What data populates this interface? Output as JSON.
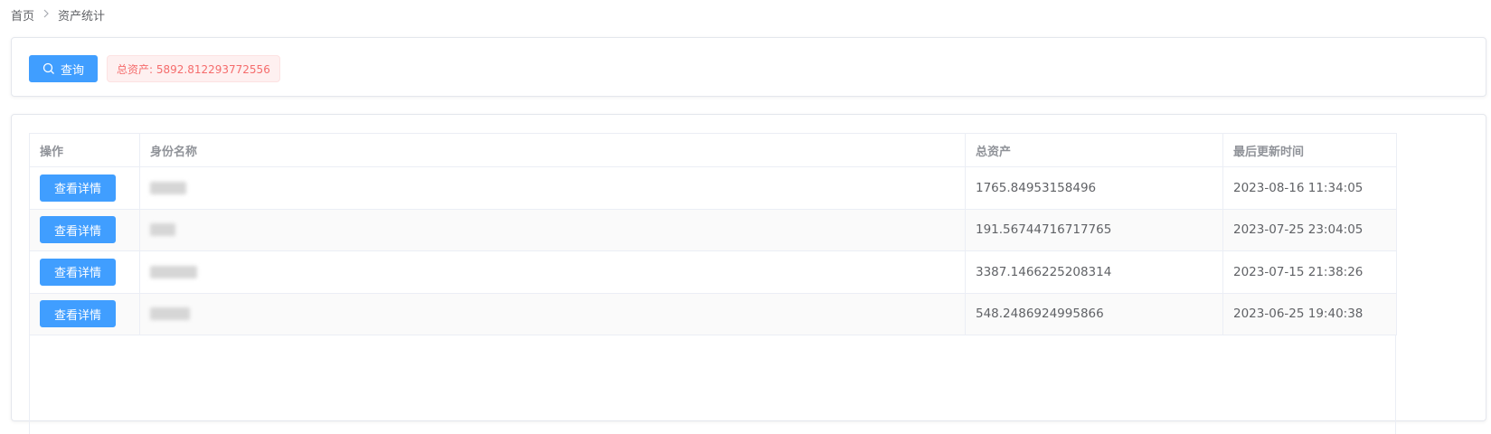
{
  "breadcrumb": {
    "home": "首页",
    "current": "资产统计"
  },
  "query": {
    "search_button_label": "查询",
    "total_tag": "总资产: 5892.812293772556"
  },
  "table": {
    "headers": {
      "action": "操作",
      "identity_name": "身份名称",
      "total_assets": "总资产",
      "last_updated": "最后更新时间"
    },
    "rows": [
      {
        "action_label": "查看详情",
        "identity_name": "",
        "total_assets": "1765.84953158496",
        "last_updated": "2023-08-16 11:34:05"
      },
      {
        "action_label": "查看详情",
        "identity_name": "",
        "total_assets": "191.56744716717765",
        "last_updated": "2023-07-25 23:04:05"
      },
      {
        "action_label": "查看详情",
        "identity_name": "",
        "total_assets": "3387.1466225208314",
        "last_updated": "2023-07-15 21:38:26"
      },
      {
        "action_label": "查看详情",
        "identity_name": "",
        "total_assets": "548.2486924995866",
        "last_updated": "2023-06-25 19:40:38"
      }
    ]
  },
  "icons": {
    "search": "search-icon",
    "breadcrumb_separator": "chevron-right-icon"
  },
  "colors": {
    "primary": "#409eff",
    "danger": "#f56c6c"
  }
}
